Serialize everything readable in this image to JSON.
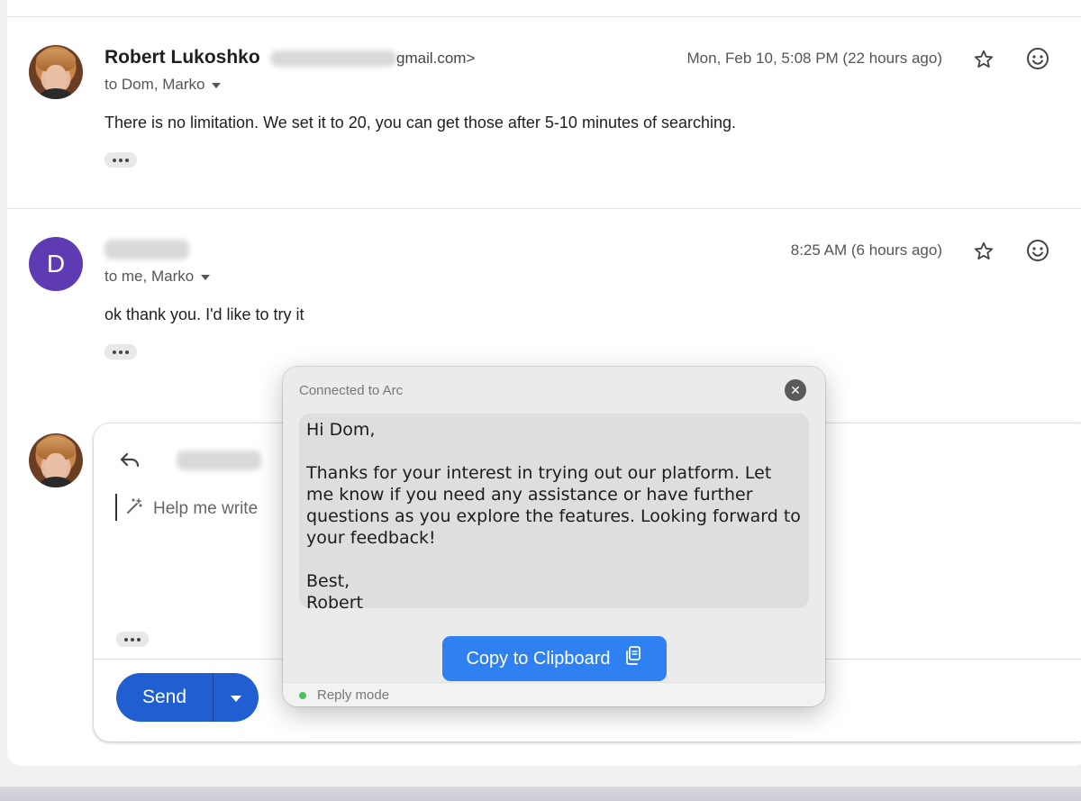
{
  "messages": [
    {
      "sender": "Robert Lukoshko",
      "email_suffix": "gmail.com>",
      "recipients": "to Dom, Marko",
      "time": "Mon, Feb 10, 5:08 PM (22 hours ago)",
      "body": "There is no limitation. We set it to 20, you can get those after 5-10 minutes of searching."
    },
    {
      "avatar_letter": "D",
      "recipients": "to me, Marko",
      "time": "8:25 AM (6 hours ago)",
      "body": "ok thank you. I'd like to try it"
    }
  ],
  "reply": {
    "help_me_write": "Help me write",
    "send_label": "Send"
  },
  "popup": {
    "title": "Connected to Arc",
    "text": "Hi Dom,\n\nThanks for your interest in trying out our platform. Let me know if you need any assistance or have further questions as you explore the features. Looking forward to your feedback!\n\nBest,\nRobert",
    "copy_button": "Copy to Clipboard",
    "mode": "Reply mode"
  },
  "icons": {
    "star": "star-icon",
    "emoji": "emoji-icon",
    "reply": "reply-arrow-icon",
    "pen": "magic-pen-icon",
    "clipboard": "clipboard-icon",
    "close": "close-icon"
  }
}
